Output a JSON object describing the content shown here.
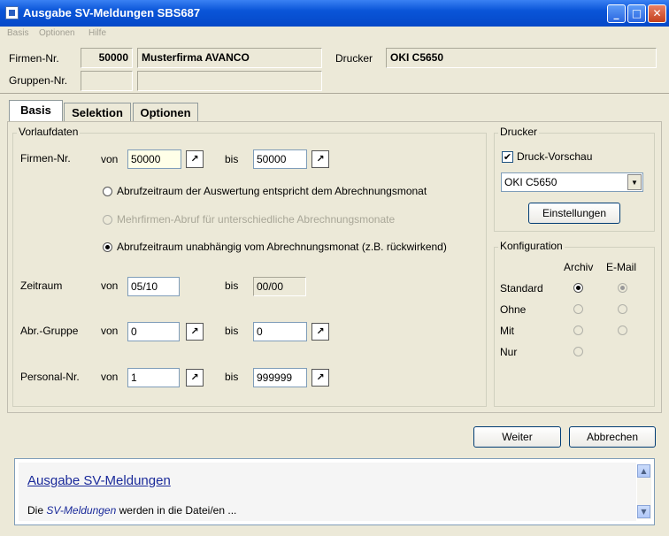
{
  "window": {
    "title": "Ausgabe SV-Meldungen SBS687",
    "controls": {
      "minimize": "_",
      "maximize": "□",
      "close": "✕"
    }
  },
  "menu": [
    "Basis",
    "Optionen",
    "Hilfe"
  ],
  "header": {
    "firmen_label": "Firmen-Nr.",
    "firmen_nr": "50000",
    "firmen_name": "Musterfirma AVANCO",
    "drucker_label": "Drucker",
    "drucker_value": "OKI C5650",
    "gruppen_label": "Gruppen-Nr.",
    "gruppen_nr": "",
    "gruppen_name": ""
  },
  "tabs": [
    "Basis",
    "Selektion",
    "Optionen"
  ],
  "vorlaufdaten": {
    "title": "Vorlaufdaten",
    "firmen": {
      "label": "Firmen-Nr.",
      "von_label": "von",
      "von": "50000",
      "bis_label": "bis",
      "bis": "50000"
    },
    "radio_1": "Abrufzeitraum der Auswertung entspricht dem Abrechnungsmonat",
    "radio_2": "Mehrfirmen-Abruf für unterschiedliche Abrechnungsmonate",
    "radio_3": "Abrufzeitraum unabhängig vom Abrechnungsmonat (z.B. rückwirkend)",
    "zeitraum": {
      "label": "Zeitraum",
      "von_label": "von",
      "von": "05/10",
      "bis_label": "bis",
      "bis": "00/00"
    },
    "abr_gruppe": {
      "label": "Abr.-Gruppe",
      "von_label": "von",
      "von": "0",
      "bis_label": "bis",
      "bis": "0"
    },
    "personal": {
      "label": "Personal-Nr.",
      "von_label": "von",
      "von": "1",
      "bis_label": "bis",
      "bis": "999999"
    }
  },
  "drucker_group": {
    "title": "Drucker",
    "druck_vorschau": "Druck-Vorschau",
    "druck_vorschau_checked": true,
    "selected_printer": "OKI C5650",
    "einstellungen": "Einstellungen"
  },
  "konfiguration": {
    "title": "Konfiguration",
    "col_archiv": "Archiv",
    "col_email": "E-Mail",
    "rows": [
      "Standard",
      "Ohne",
      "Mit",
      "Nur"
    ]
  },
  "buttons": {
    "weiter": "Weiter",
    "abbrechen": "Abbrechen"
  },
  "help": {
    "title": "Ausgabe SV-Meldungen",
    "text_prefix": "Die ",
    "text_em": "SV-Meldungen",
    "text_suffix": " werden in die Datei/en ..."
  },
  "icons": {
    "arrow": "↗",
    "up": "▲",
    "down": "▼",
    "dropdown": "▼",
    "check": "✔"
  }
}
